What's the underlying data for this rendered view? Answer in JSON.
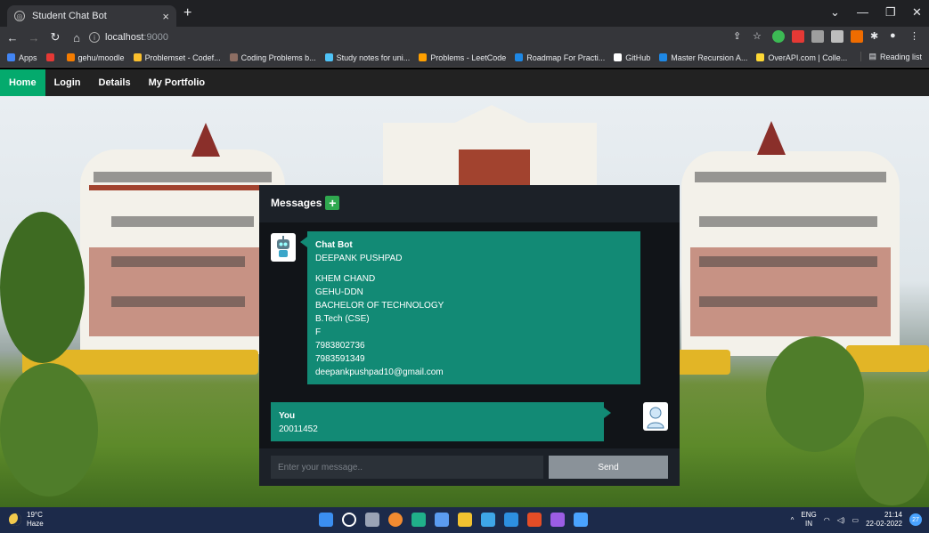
{
  "browser": {
    "tab_title": "Student Chat Bot",
    "tab_close": "×",
    "new_tab": "+",
    "url_host": "localhost",
    "url_port": ":9000",
    "window_controls": [
      "⌄",
      "—",
      "❐",
      "✕"
    ]
  },
  "bookmarks": [
    {
      "label": "Apps",
      "color": "#4285f4"
    },
    {
      "label": "",
      "color": "#e53935"
    },
    {
      "label": "gehu/moodle",
      "color": "#f57c00"
    },
    {
      "label": "Problemset - Codef...",
      "color": "#fbc02d"
    },
    {
      "label": "Coding Problems b...",
      "color": "#8d6e63"
    },
    {
      "label": "Study notes for uni...",
      "color": "#4fc3f7"
    },
    {
      "label": "Problems - LeetCode",
      "color": "#ffa000"
    },
    {
      "label": "Roadmap For Practi...",
      "color": "#1e88e5"
    },
    {
      "label": "GitHub",
      "color": "#ffffff"
    },
    {
      "label": "Master Recursion A...",
      "color": "#1e88e5"
    },
    {
      "label": "OverAPI.com | Colle...",
      "color": "#fdd835"
    }
  ],
  "reading_list": "Reading list",
  "site_nav": [
    {
      "label": "Home",
      "active": true
    },
    {
      "label": "Login",
      "active": false
    },
    {
      "label": "Details",
      "active": false
    },
    {
      "label": "My Portfolio",
      "active": false
    }
  ],
  "chat": {
    "header": "Messages",
    "header_add": "+",
    "bot_name": "Chat Bot",
    "bot_lines": [
      "DEEPANK PUSHPAD",
      "KHEM CHAND",
      "GEHU-DDN",
      "BACHELOR OF TECHNOLOGY",
      "B.Tech (CSE)",
      "F",
      "7983802736",
      "7983591349",
      "deepankpushpad10@gmail.com"
    ],
    "user_name": "You",
    "user_message": "20011452",
    "input_placeholder": "Enter your message..",
    "send_label": "Send"
  },
  "taskbar": {
    "temp": "19°C",
    "condition": "Haze",
    "lang_top": "ENG",
    "lang_bottom": "IN",
    "time": "21:14",
    "date": "22-02-2022",
    "notif_count": "27"
  },
  "colors": {
    "accent_green": "#04aa6d",
    "bubble_teal": "#128a75"
  }
}
